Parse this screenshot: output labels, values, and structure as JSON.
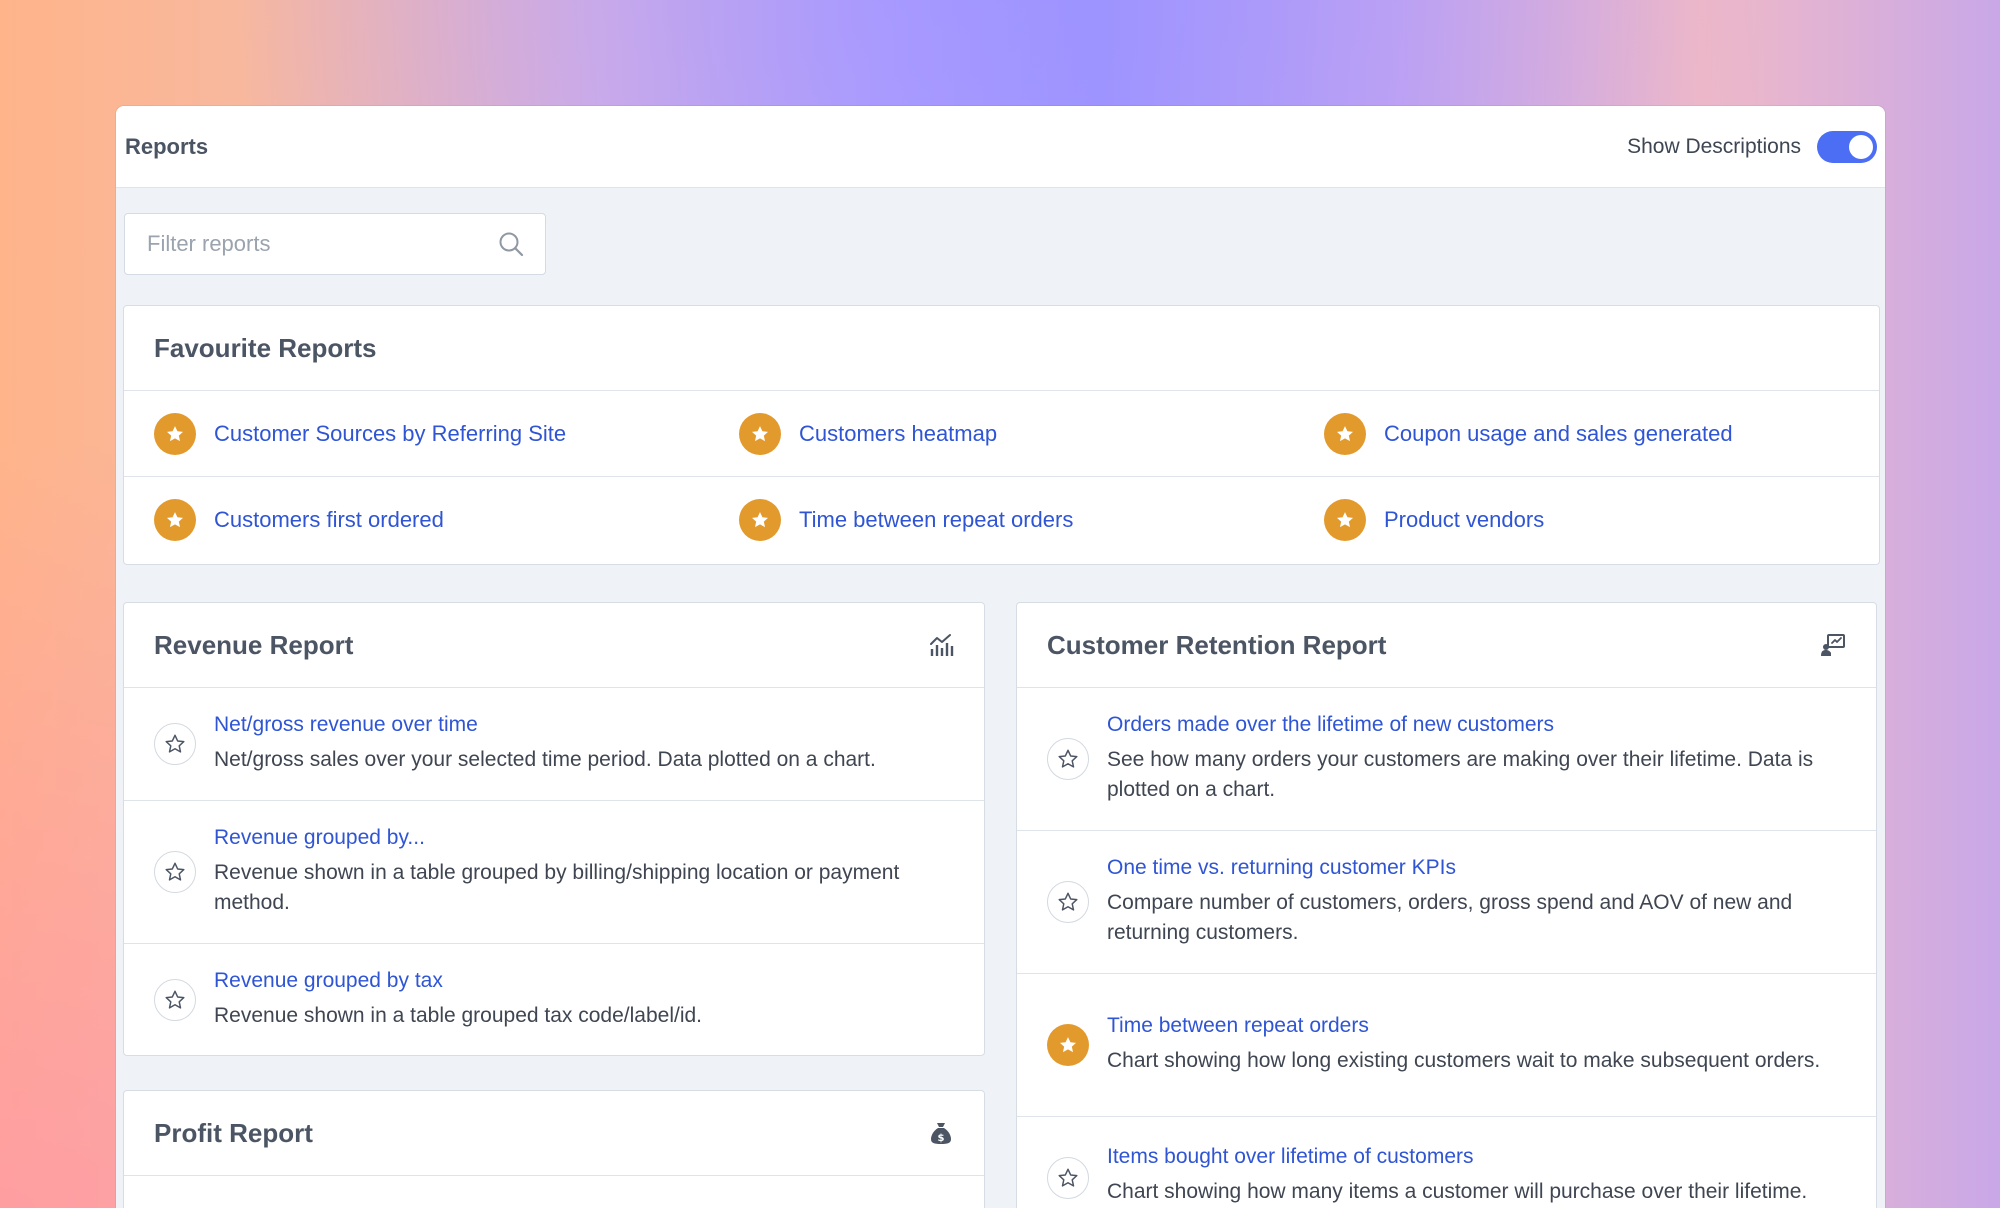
{
  "topbar": {
    "title": "Reports",
    "show_descriptions_label": "Show Descriptions",
    "show_descriptions_on": true,
    "accent": "#4c6ef5"
  },
  "search": {
    "placeholder": "Filter reports",
    "value": ""
  },
  "favourites": {
    "title": "Favourite Reports",
    "rows": [
      [
        "Customer Sources by Referring Site",
        "Customers heatmap",
        "Coupon usage and sales generated"
      ],
      [
        "Customers first ordered",
        "Time between repeat orders",
        "Product vendors"
      ]
    ],
    "star_color": "#e39a2d"
  },
  "revenue": {
    "title": "Revenue Report",
    "icon": "chart-icon",
    "items": [
      {
        "title": "Net/gross revenue over time",
        "desc": "Net/gross sales over your selected time period. Data plotted on a chart.",
        "favourite": false
      },
      {
        "title": "Revenue grouped by...",
        "desc": "Revenue shown in a table grouped by billing/shipping location or payment method.",
        "favourite": false
      },
      {
        "title": "Revenue grouped by tax",
        "desc": "Revenue shown in a table grouped tax code/label/id.",
        "favourite": false
      }
    ]
  },
  "retention": {
    "title": "Customer Retention Report",
    "icon": "presentation-icon",
    "items": [
      {
        "title": "Orders made over the lifetime of new customers",
        "desc": "See how many orders your customers are making over their lifetime. Data is plotted on a chart.",
        "favourite": false
      },
      {
        "title": "One time vs. returning customer KPIs",
        "desc": "Compare number of customers, orders, gross spend and AOV of new and returning customers.",
        "favourite": false
      },
      {
        "title": "Time between repeat orders",
        "desc": "Chart showing how long existing customers wait to make subsequent orders.",
        "favourite": true
      },
      {
        "title": "Items bought over lifetime of customers",
        "desc": "Chart showing how many items a customer will purchase over their lifetime.",
        "favourite": false
      }
    ]
  },
  "profit": {
    "title": "Profit Report",
    "icon": "money-bag-icon"
  }
}
